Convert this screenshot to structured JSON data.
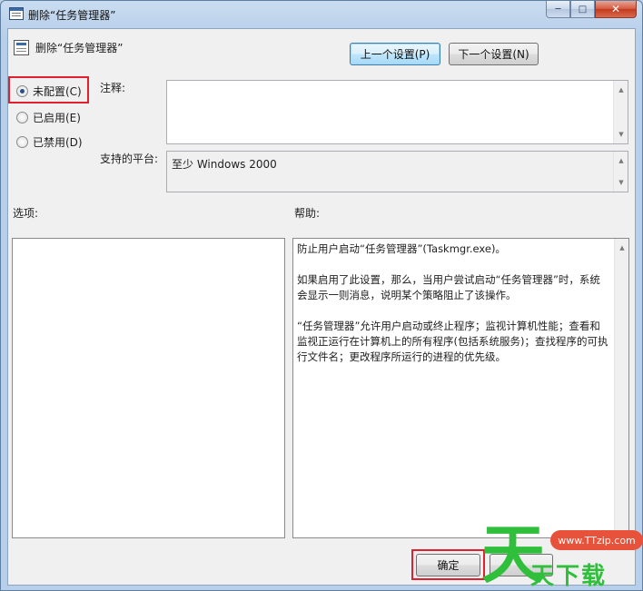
{
  "window": {
    "title": "删除“任务管理器”",
    "buttons": {
      "minimize": "─",
      "maximize": "□",
      "close": "✕"
    }
  },
  "header": {
    "policy_name": "删除“任务管理器”",
    "prev_button": "上一个设置(P)",
    "next_button": "下一个设置(N)"
  },
  "state": {
    "options": [
      {
        "label": "未配置(C)",
        "checked": true
      },
      {
        "label": "已启用(E)",
        "checked": false
      },
      {
        "label": "已禁用(D)",
        "checked": false
      }
    ]
  },
  "comment": {
    "label": "注释:",
    "value": ""
  },
  "platform": {
    "label": "支持的平台:",
    "value": "至少 Windows 2000"
  },
  "options_pane": {
    "label": "选项:"
  },
  "help_pane": {
    "label": "帮助:",
    "paragraphs": [
      "防止用户启动“任务管理器”(Taskmgr.exe)。",
      "如果启用了此设置，那么，当用户尝试启动“任务管理器”时，系统会显示一则消息，说明某个策略阻止了该操作。",
      "“任务管理器”允许用户启动或终止程序；监视计算机性能；查看和监视正运行在计算机上的所有程序(包括系统服务)；查找程序的可执行文件名；更改程序所运行的进程的优先级。"
    ]
  },
  "footer": {
    "ok_button": "确定"
  },
  "watermark": {
    "big": "天",
    "url": "www.TTzip.com",
    "small": "天下载"
  },
  "colors": {
    "highlight": "#e0202e",
    "watermark_green": "#2fbf3b",
    "watermark_red": "#e8523a"
  }
}
